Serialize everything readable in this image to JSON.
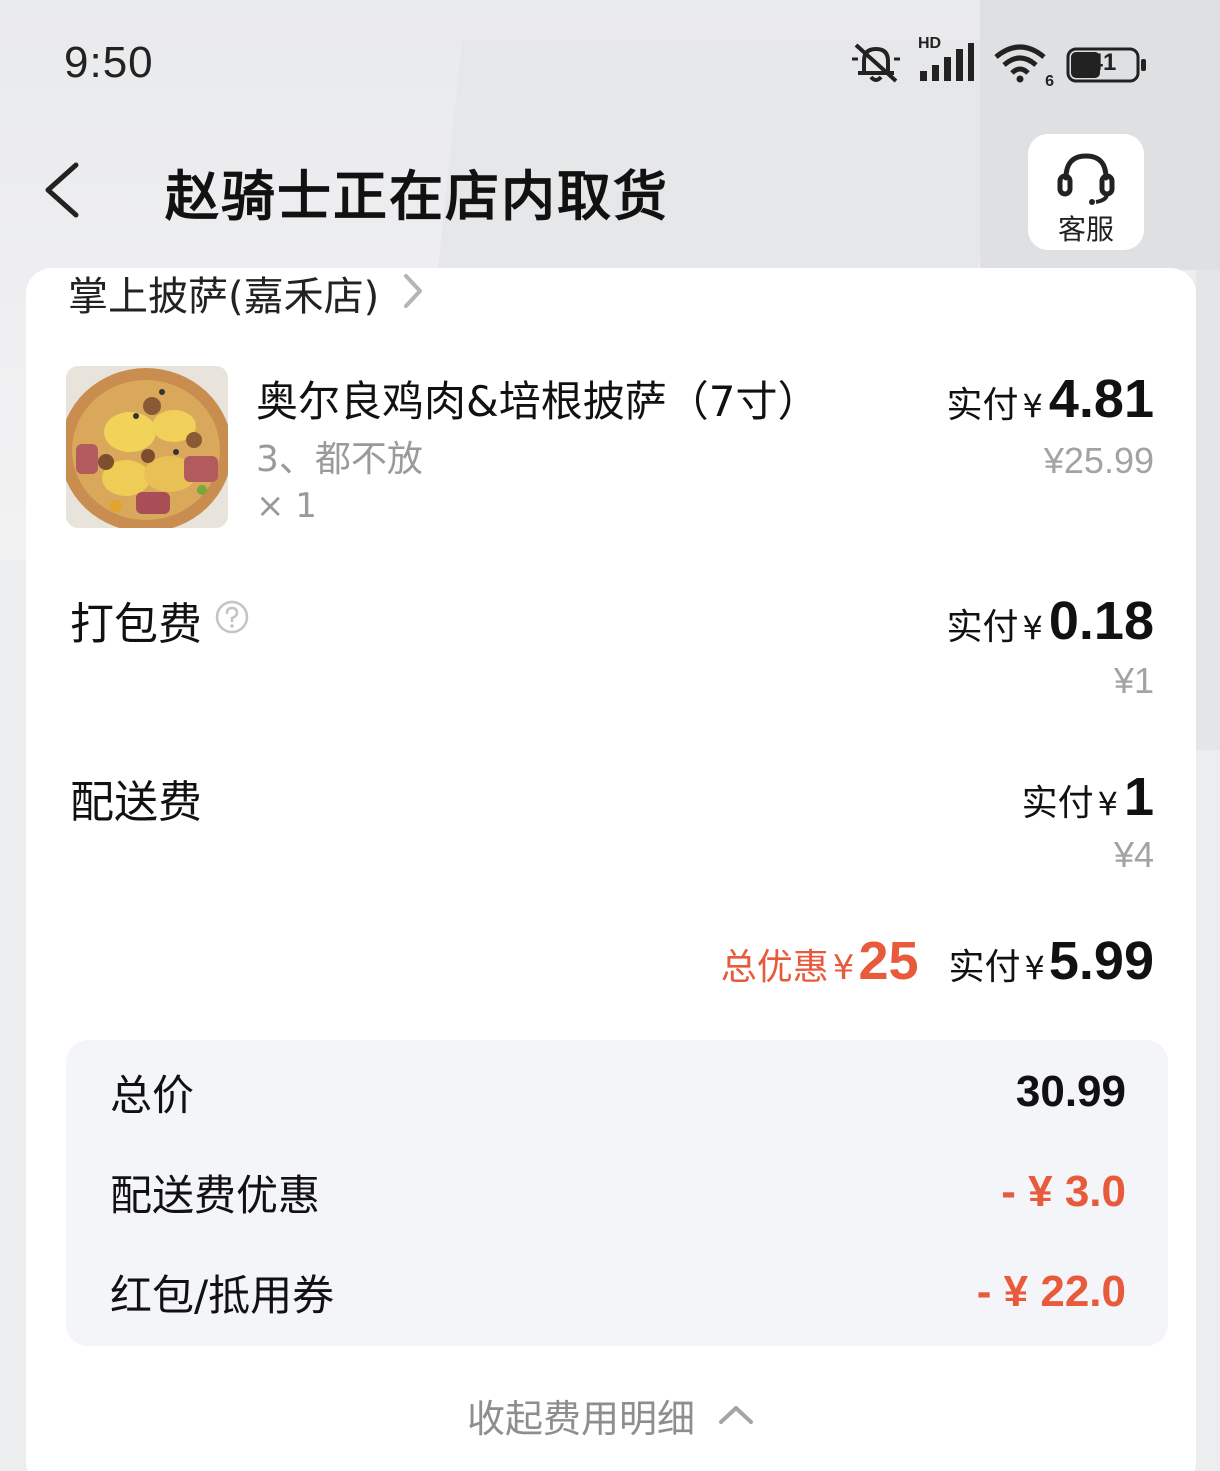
{
  "status_bar": {
    "time": "9:50",
    "battery": "41",
    "network_label": "HD",
    "wifi_label": "6",
    "icons": [
      "mute-bell-icon",
      "signal-icon",
      "wifi-icon",
      "battery-icon"
    ]
  },
  "header": {
    "title": "赵骑士正在店内取货",
    "service_label": "客服"
  },
  "store": {
    "name": "掌上披萨(嘉禾店)"
  },
  "item": {
    "name": "奥尔良鸡肉&培根披萨（7寸）",
    "spec": "3、都不放",
    "qty": "× 1",
    "paid_label": "实付",
    "currency": "¥",
    "paid_amount": "4.81",
    "original": "¥25.99"
  },
  "packing_fee": {
    "label": "打包费",
    "paid_label": "实付",
    "currency": "¥",
    "paid_amount": "0.18",
    "original": "¥1"
  },
  "delivery_fee": {
    "label": "配送费",
    "paid_label": "实付",
    "currency": "¥",
    "paid_amount": "1",
    "original": "¥4"
  },
  "summary": {
    "discount_label": "总优惠",
    "currency": "¥",
    "discount_amount": "25",
    "paid_label": "实付",
    "paid_amount": "5.99"
  },
  "details": {
    "total_label": "总价",
    "total_value": "30.99",
    "delivery_discount_label": "配送费优惠",
    "delivery_discount_value": "- ¥ 3.0",
    "coupon_label": "红包/抵用券",
    "coupon_value": "- ¥ 22.0"
  },
  "collapse_label": "收起费用明细",
  "colors": {
    "accent_red": "#e85a3c",
    "card_bg": "#ffffff",
    "detail_bg": "#f3f5f9"
  }
}
